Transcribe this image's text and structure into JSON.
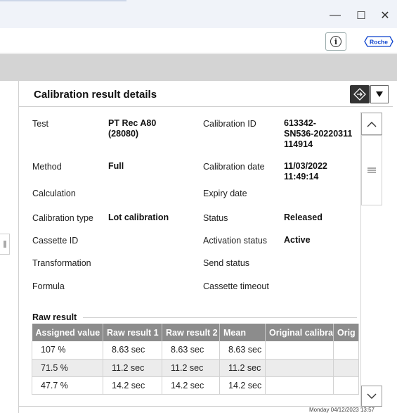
{
  "window": {
    "minimize": "—",
    "maximize": "☐",
    "close": "✕"
  },
  "toolbar": {
    "info": "i",
    "brand": "Roche"
  },
  "panel": {
    "title": "Calibration result details"
  },
  "details_left": [
    {
      "label": "Test",
      "value": "PT Rec A80\n(28080)"
    },
    {
      "label": "Method",
      "value": "Full"
    },
    {
      "label": "Calculation",
      "value": ""
    },
    {
      "label": "Calibration type",
      "value": "Lot calibration"
    },
    {
      "label": "Cassette ID",
      "value": ""
    },
    {
      "label": "Transformation",
      "value": ""
    },
    {
      "label": "Formula",
      "value": ""
    }
  ],
  "details_right": [
    {
      "label": "Calibration ID",
      "value": "613342-\nSN536-20220311\n114914"
    },
    {
      "label": "Calibration date",
      "value": "11/03/2022\n11:49:14"
    },
    {
      "label": "Expiry date",
      "value": ""
    },
    {
      "label": "Status",
      "value": "Released"
    },
    {
      "label": "Activation status",
      "value": "Active"
    },
    {
      "label": "Send status",
      "value": ""
    },
    {
      "label": "Cassette timeout",
      "value": ""
    }
  ],
  "raw_result": {
    "title": "Raw result",
    "columns": [
      "Assigned value",
      "Raw result 1",
      "Raw result 2",
      "Mean",
      "Original calibra",
      "Orig"
    ],
    "rows": [
      [
        "107 %",
        "8.63 sec",
        "8.63 sec",
        "8.63 sec",
        "",
        ""
      ],
      [
        "71.5 %",
        "11.2 sec",
        "11.2 sec",
        "11.2 sec",
        "",
        ""
      ],
      [
        "47.7 %",
        "14.2 sec",
        "14.2 sec",
        "14.2 sec",
        "",
        ""
      ]
    ]
  },
  "status_bar": {
    "datetime": "Monday  04/12/2023 13:57"
  },
  "icons": {
    "info": "info-icon",
    "brand": "roche-logo",
    "nav": "navigate-icon",
    "dropdown": "triangle-down-icon",
    "scroll_up": "chevron-up-icon",
    "scroll_down": "chevron-down-icon",
    "menu": "menu-lines-icon",
    "handle": "sidebar-handle-icon"
  },
  "colors": {
    "header_gray": "#8c8c8c",
    "band_gray": "#d4d4d4",
    "brand_blue": "#0b41cd"
  }
}
